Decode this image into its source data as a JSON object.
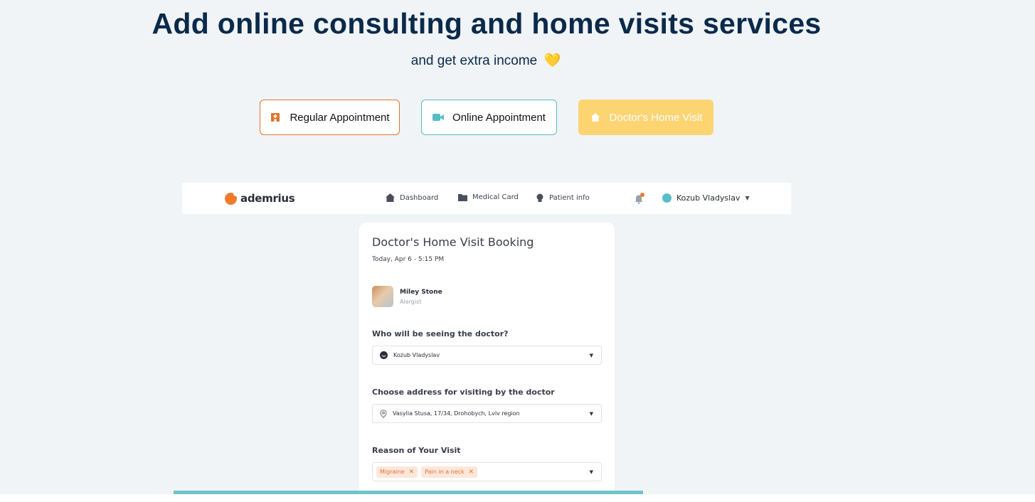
{
  "hero": {
    "title": "Add online consulting and home visits services",
    "subtitle": "and get extra income",
    "heart": "💛"
  },
  "services": {
    "regular": "Regular Appointment",
    "online": "Online Appointment",
    "home": "Doctor's Home Visit"
  },
  "nav": {
    "logo": "ademrius",
    "dashboard": "Dashboard",
    "medical_card": "Medical Card",
    "patient_info": "Patient info",
    "user": "Kozub Vladyslav"
  },
  "booking": {
    "title": "Doctor's Home Visit Booking",
    "date": "Today, Apr 6 - 5:15 PM",
    "doctor_name": "Miley Stone",
    "doctor_role": "Alergist",
    "who_label": "Who will be seeing the doctor?",
    "who_value": "Kozub Vladyslav",
    "address_label": "Choose address for visiting by the doctor",
    "address_value": "Vasylia Stusa, 17/34, Drohobych, Lviv region",
    "reason_label": "Reason of Your Visit",
    "reasons": [
      "Migraine",
      "Pain in a neck"
    ]
  },
  "colors": {
    "title": "#0b2a4a",
    "orange": "#e0742e",
    "teal": "#58bdc8",
    "yellow": "#fcd472",
    "bar": "#6ec5c7"
  }
}
